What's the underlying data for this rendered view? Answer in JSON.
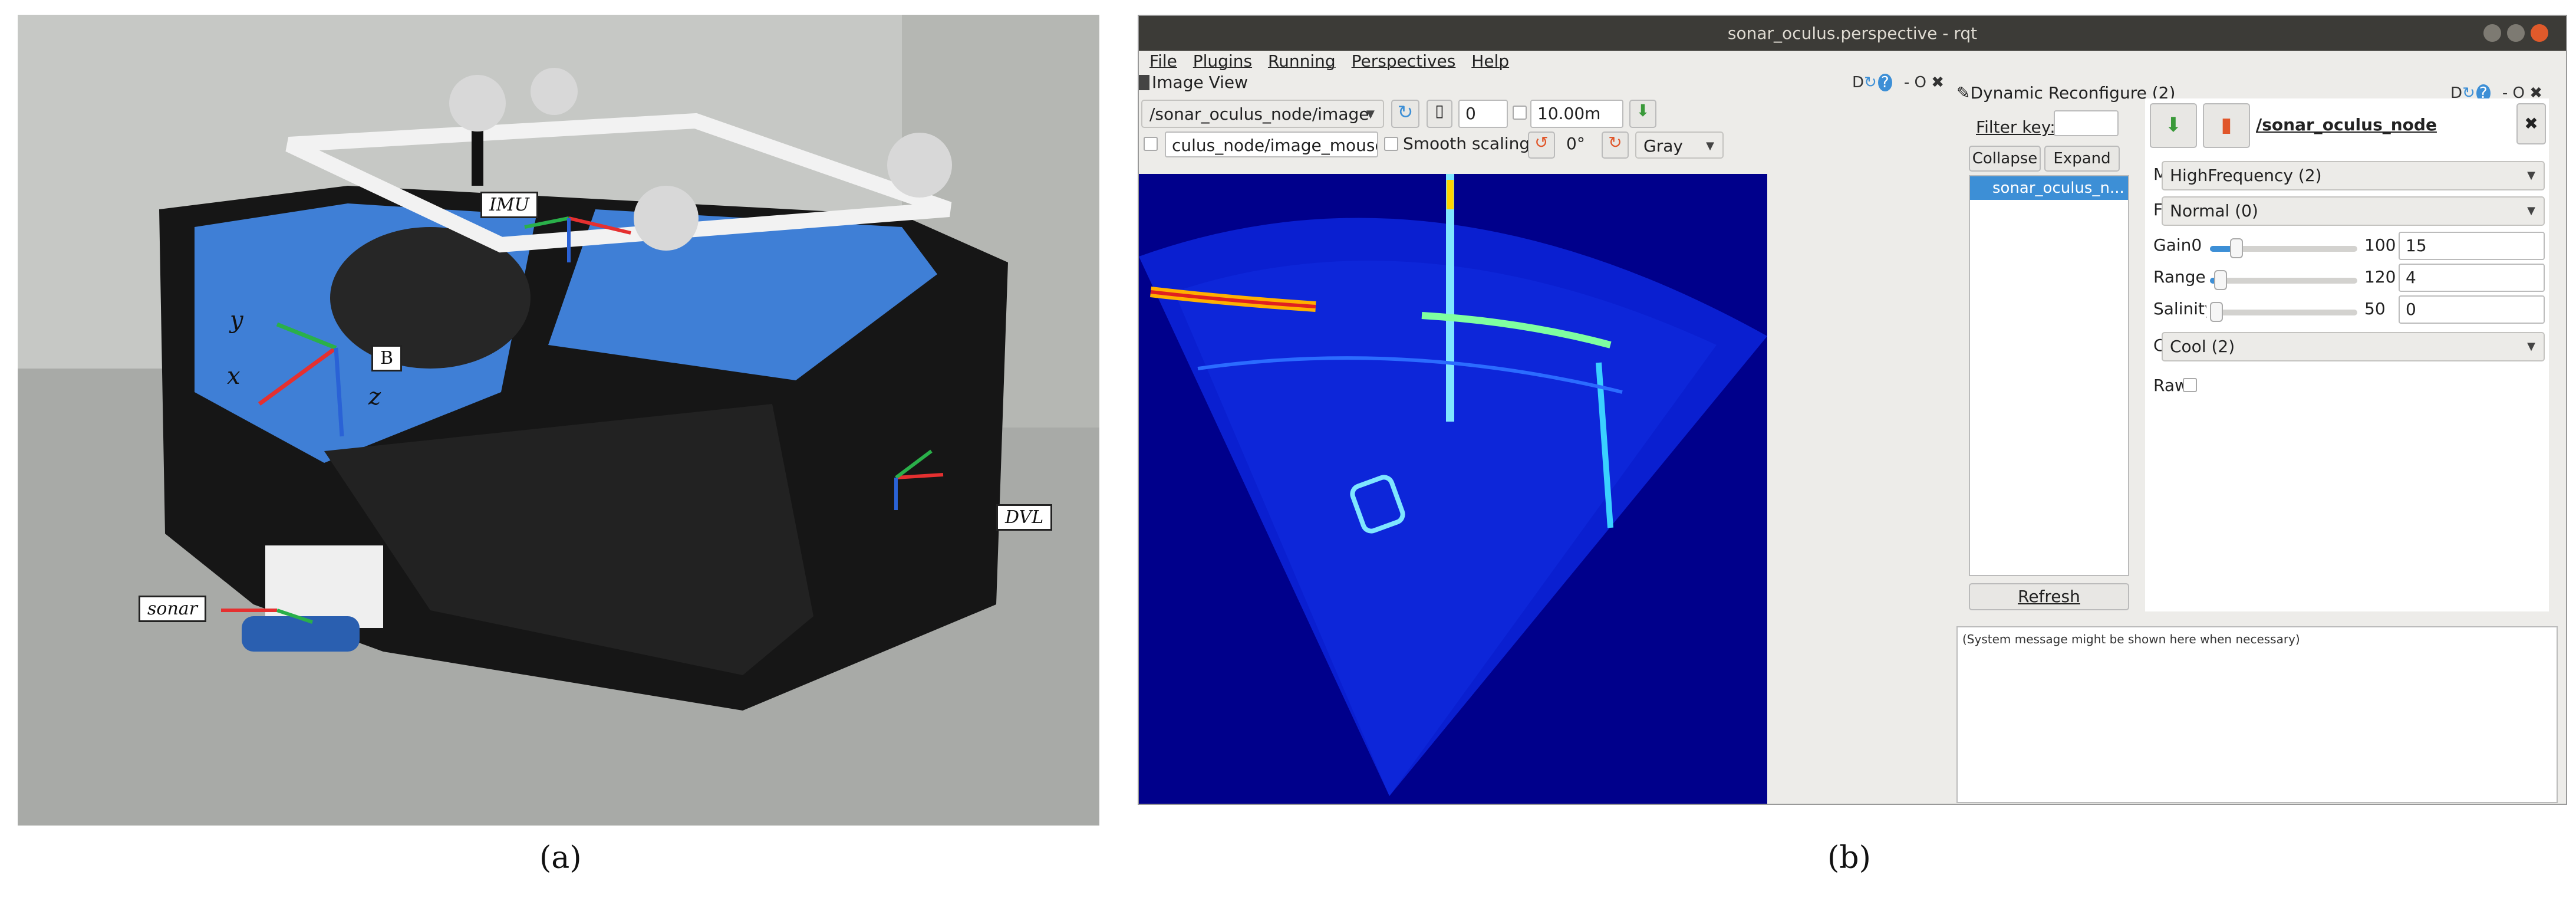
{
  "figure": {
    "captions": {
      "a": "(a)",
      "b": "(b)"
    },
    "photo": {
      "labels": {
        "imu": "IMU",
        "body": "B",
        "dvl": "DVL",
        "sonar": "sonar"
      },
      "axes": {
        "x": "x",
        "y": "y",
        "z": "z"
      },
      "colors": {
        "vehicle_blue": "#3f7fd6",
        "frame_black": "#161616",
        "marker_gray": "#d8d8d8"
      }
    }
  },
  "rqt": {
    "window_title": "sonar_oculus.perspective - rqt",
    "menu": [
      "File",
      "Plugins",
      "Running",
      "Perspectives",
      "Help"
    ],
    "image_view": {
      "title": "Image View",
      "dock_controls": "D",
      "dock_min_close": "- O ✖",
      "topic": "/sonar_oculus_node/image",
      "spin_value": "0",
      "range_value": "10.00m",
      "mouse_topic": "culus_node/image_mouse_left",
      "smooth_scaling": "Smooth scaling",
      "rotation": "0°",
      "colormap": "Gray"
    },
    "dynamic_reconfigure": {
      "title": "Dynamic Reconfigure (2)",
      "dock_controls": "D",
      "dock_min_close": "- O ✖",
      "filter_label": "Filter key:",
      "filter_value": "",
      "collapse_all": "Collapse all",
      "expand_all": "Expand all",
      "nodes": [
        "sonar_oculus_n..."
      ],
      "refresh": "Refresh",
      "node_name": "/sonar_oculus_node",
      "params": {
        "mode_label": "M",
        "mode_value": "HighFrequency (2)",
        "ping_label": "F",
        "ping_value": "Normal (0)",
        "gain": {
          "label": "Gain",
          "min": "0",
          "max": "100",
          "value": "15",
          "fraction": 0.15
        },
        "range": {
          "label": "Range",
          "min": "0",
          "max": "120",
          "value": "4",
          "fraction": 0.03
        },
        "salinity": {
          "label": "Salinity",
          "min": "0",
          "max": "50",
          "value": "0",
          "fraction": 0.0
        },
        "colormap_label": "C",
        "colormap_value": "Cool (2)",
        "raw_label": "Raw"
      },
      "system_message": "(System message might be shown here when necessary)"
    },
    "colors": {
      "titlebar": "#3c3b37",
      "selection": "#3d8fd6",
      "sonar_bg": "#00008b"
    }
  }
}
